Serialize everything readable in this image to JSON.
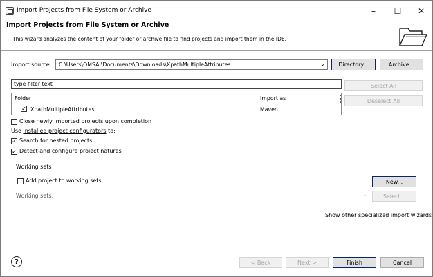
{
  "window": {
    "title": "Import Projects from File System or Archive",
    "controls": {
      "minimize": "–",
      "maximize": "☐",
      "close": "✕"
    }
  },
  "header": {
    "title": "Import Projects from File System or Archive",
    "description": "This wizard analyzes the content of your folder or archive file to find projects and import them in the IDE.",
    "icon": "open-folder-icon"
  },
  "import_source": {
    "label": "Import source:",
    "value": "C:\\Users\\OMSAI\\Documents\\Downloads\\XpathMultipleAttributes",
    "directory_button": "Directory...",
    "archive_button": "Archive..."
  },
  "filter": {
    "placeholder": "type filter text"
  },
  "table": {
    "headers": {
      "folder": "Folder",
      "import_as": "Import as"
    },
    "rows": [
      {
        "folder": "XpathMultipleAttributes",
        "import_as": "Maven",
        "checked": true
      }
    ]
  },
  "side_buttons": {
    "select_all": "Select All",
    "deselect_all": "Deselect All"
  },
  "options": {
    "close_projects": {
      "label": "Close newly imported projects upon completion",
      "checked": false
    },
    "use_installed_prefix": "Use",
    "use_installed_link": "installed project configurators",
    "use_installed_suffix": "to:",
    "search_nested": {
      "label": "Search for nested projects",
      "checked": true
    },
    "detect_natures": {
      "label": "Detect and configure project natures",
      "checked": true
    }
  },
  "working_sets": {
    "section_label": "Working sets",
    "add_label": "Add project to working sets",
    "add_checked": false,
    "new_button": "New...",
    "working_sets_label": "Working sets:",
    "select_button": "Select..."
  },
  "wizards_link": "Show other specialized import wizards",
  "footer": {
    "help": "?",
    "back": "< Back",
    "next": "Next >",
    "finish": "Finish",
    "cancel": "Cancel"
  }
}
